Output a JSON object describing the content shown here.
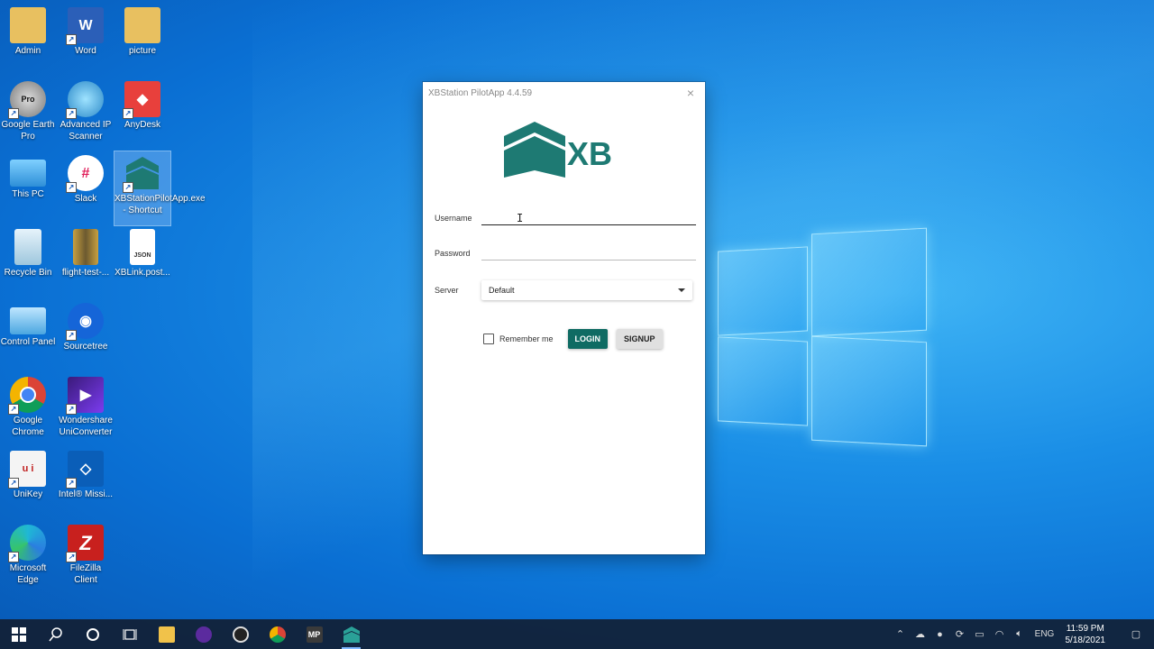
{
  "desktop": {
    "icons": [
      {
        "label": "Admin",
        "icon": "folder-user-icon"
      },
      {
        "label": "Word",
        "icon": "word-icon",
        "glyph": "W"
      },
      {
        "label": "picture",
        "icon": "folder-icon"
      },
      {
        "label": "Google Earth Pro",
        "icon": "google-earth-icon",
        "glyph": "Pro"
      },
      {
        "label": "Advanced IP Scanner",
        "icon": "ip-scanner-icon"
      },
      {
        "label": "AnyDesk",
        "icon": "anydesk-icon"
      },
      {
        "label": "This PC",
        "icon": "computer-icon"
      },
      {
        "label": "Slack",
        "icon": "slack-icon"
      },
      {
        "label": "XBStationPilotApp.exe - Shortcut",
        "icon": "xb-app-icon"
      },
      {
        "label": "Recycle Bin",
        "icon": "recycle-bin-icon"
      },
      {
        "label": "flight-test-...",
        "icon": "archive-icon"
      },
      {
        "label": "XBLink.post...",
        "icon": "json-file-icon",
        "glyph": "JSON"
      },
      {
        "label": "Control Panel",
        "icon": "control-panel-icon"
      },
      {
        "label": "Sourcetree",
        "icon": "sourcetree-icon"
      },
      {
        "label": "Google Chrome",
        "icon": "chrome-icon"
      },
      {
        "label": "Wondershare UniConverter",
        "icon": "uniconverter-icon"
      },
      {
        "label": "UniKey",
        "icon": "unikey-icon"
      },
      {
        "label": "Intel® Missi...",
        "icon": "intel-icon"
      },
      {
        "label": "Microsoft Edge",
        "icon": "edge-icon"
      },
      {
        "label": "FileZilla Client",
        "icon": "filezilla-icon",
        "glyph": "Z"
      }
    ]
  },
  "window": {
    "title": "XBStation PilotApp 4.4.59",
    "close_glyph": "×",
    "logo_text": "XB",
    "brand_color": "#1e7a73",
    "username": {
      "label": "Username",
      "value": ""
    },
    "password": {
      "label": "Password",
      "value": ""
    },
    "server": {
      "label": "Server",
      "selected": "Default"
    },
    "remember_label": "Remember me",
    "login_label": "LOGIN",
    "signup_label": "SIGNUP"
  },
  "taskbar": {
    "apps": [
      "start-icon",
      "search-icon",
      "cortana-icon",
      "task-view-icon",
      "file-explorer-icon",
      "obs-alt-icon",
      "obs-icon",
      "chrome-icon",
      "mission-planner-icon",
      "xb-app-icon"
    ],
    "language": "ENG",
    "time": "11:59 PM",
    "date": "5/18/2021"
  }
}
